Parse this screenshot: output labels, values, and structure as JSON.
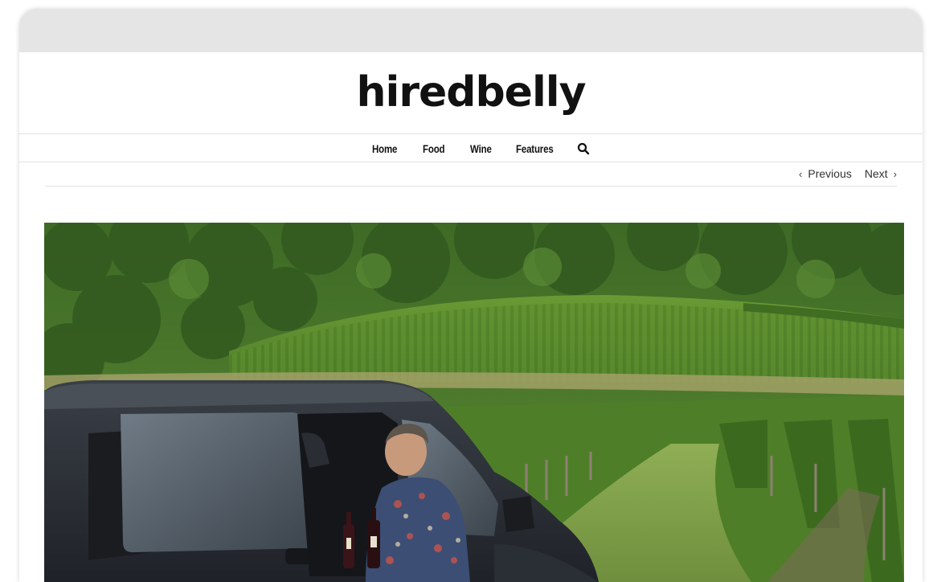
{
  "site": {
    "logo_text": "hiredbelly"
  },
  "nav": {
    "items": [
      "Home",
      "Food",
      "Wine",
      "Features"
    ],
    "search_icon": "search-icon"
  },
  "post_nav": {
    "previous_label": "Previous",
    "next_label": "Next"
  },
  "hero": {
    "image_description_icon": "photo",
    "colors": {
      "sky_foliage": "#4f7a2e",
      "vine_rows": "#5f8f2f",
      "grass": "#8aa84c",
      "van": "#2b2f36"
    }
  }
}
